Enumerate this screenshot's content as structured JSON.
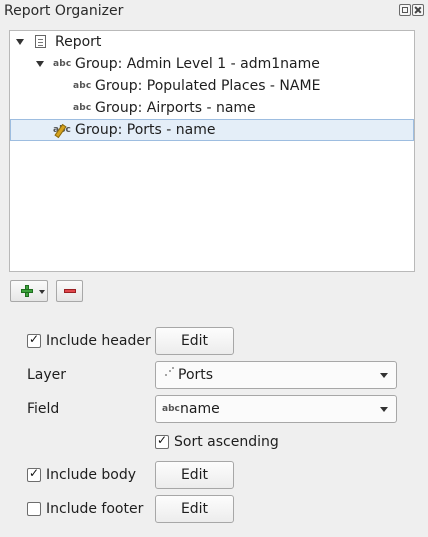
{
  "panel": {
    "title": "Report Organizer",
    "float_icon": "float-icon",
    "close_icon": "close-icon"
  },
  "tree": {
    "items": [
      {
        "label": "Report",
        "icon": "report-document-icon",
        "level": 0,
        "expanded": true
      },
      {
        "label": "Group: Admin Level 1 - adm1name",
        "icon": "abc-field-icon",
        "level": 1,
        "expanded": true
      },
      {
        "label": "Group: Populated Places - NAME",
        "icon": "abc-field-icon",
        "level": 2
      },
      {
        "label": "Group: Airports - name",
        "icon": "abc-field-icon",
        "level": 2
      },
      {
        "label": "Group: Ports - name",
        "icon": "abc-edit-icon",
        "level": 1,
        "selected": true
      }
    ]
  },
  "toolbar": {
    "add_icon": "add-section-icon",
    "remove_icon": "remove-section-icon"
  },
  "form": {
    "include_header": {
      "label": "Include header",
      "checked": true,
      "button": "Edit"
    },
    "layer": {
      "label": "Layer",
      "value": "Ports",
      "icon": "point-layer-icon"
    },
    "field": {
      "label": "Field",
      "value": "name",
      "prefix": "abc"
    },
    "sort_ascending": {
      "label": "Sort ascending",
      "checked": true
    },
    "include_body": {
      "label": "Include body",
      "checked": true,
      "button": "Edit"
    },
    "include_footer": {
      "label": "Include footer",
      "checked": false,
      "button": "Edit"
    }
  },
  "icon_text": {
    "abc": "abc"
  }
}
